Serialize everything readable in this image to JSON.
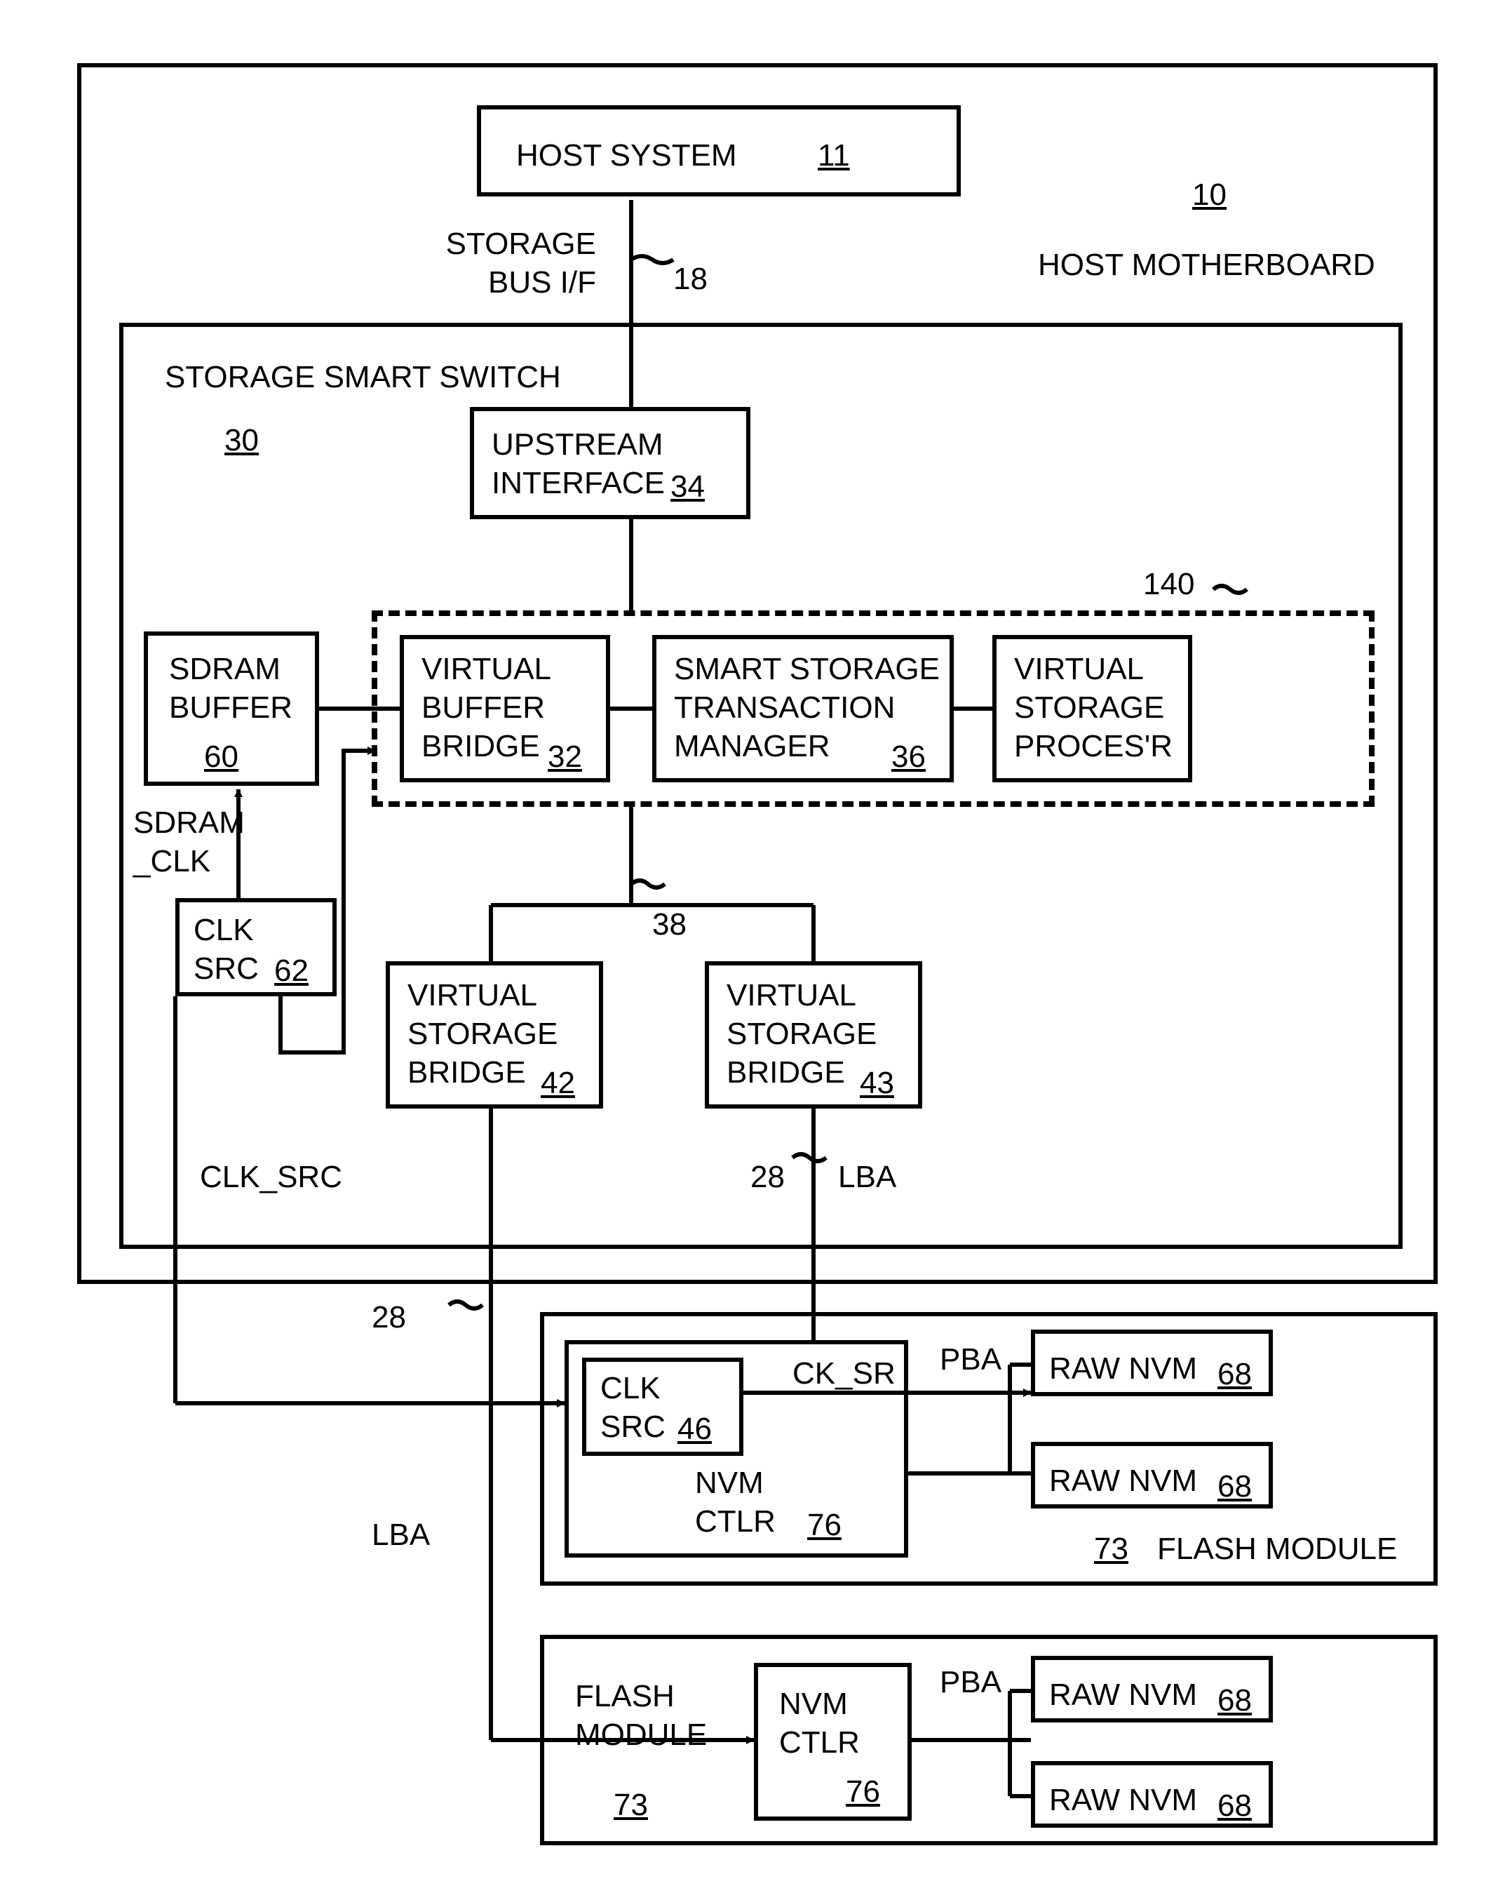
{
  "outer": {
    "host_system": "HOST SYSTEM",
    "host_system_ref": "11",
    "host_motherboard": "HOST MOTHERBOARD",
    "host_motherboard_ref": "10",
    "storage_bus_if": "STORAGE\nBUS I/F",
    "storage_bus_if_ref": "18"
  },
  "switch": {
    "title": "STORAGE SMART SWITCH",
    "ref": "30",
    "upstream_if": "UPSTREAM\nINTERFACE",
    "upstream_if_ref": "34",
    "virtual_buffer_bridge": "VIRTUAL\nBUFFER\nBRIDGE",
    "virtual_buffer_bridge_ref": "32",
    "smart_storage_mgr": "SMART STORAGE\nTRANSACTION\nMANAGER",
    "smart_storage_mgr_ref": "36",
    "virtual_storage_proc": "VIRTUAL\nSTORAGE\nPROCES'R",
    "virtual_storage_proc_ref": "140",
    "sdram_buffer": "SDRAM\nBUFFER",
    "sdram_buffer_ref": "60",
    "sdram_clk": "SDRAM\n_CLK",
    "clk_src": "CLK\nSRC",
    "clk_src_ref": "62",
    "clk_src_label": "CLK_SRC",
    "virtual_storage_bridge_a": "VIRTUAL\nSTORAGE\nBRIDGE",
    "virtual_storage_bridge_a_ref": "42",
    "virtual_storage_bridge_b": "VIRTUAL\nSTORAGE\nBRIDGE",
    "virtual_storage_bridge_b_ref": "43",
    "vsb_top_ref": "38",
    "lba": "LBA",
    "bus_28a": "28",
    "bus_28b": "28"
  },
  "flash1": {
    "title": "FLASH MODULE",
    "ref": "73",
    "nvm_ctlr": "NVM\nCTLR",
    "nvm_ctlr_ref": "76",
    "clk_src": "CLK\nSRC",
    "clk_src_ref": "46",
    "ck_sr": "CK_SR",
    "pba": "PBA",
    "raw_nvm_a": "RAW NVM",
    "raw_nvm_a_ref": "68",
    "raw_nvm_b": "RAW NVM",
    "raw_nvm_b_ref": "68"
  },
  "flash2": {
    "title": "FLASH\nMODULE",
    "ref": "73",
    "nvm_ctlr": "NVM\nCTLR",
    "nvm_ctlr_ref": "76",
    "pba": "PBA",
    "raw_nvm_a": "RAW NVM",
    "raw_nvm_a_ref": "68",
    "raw_nvm_b": "RAW NVM",
    "raw_nvm_b_ref": "68"
  }
}
